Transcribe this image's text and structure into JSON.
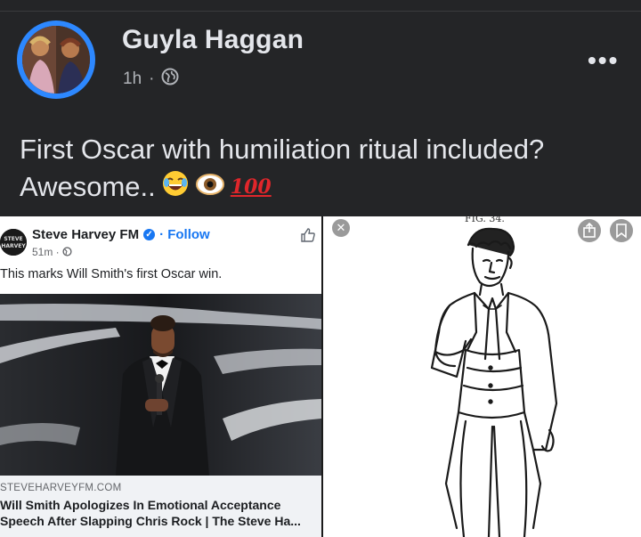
{
  "post": {
    "author": "Guyla Haggan",
    "time": "1h",
    "separator": "·",
    "text_line1": "First Oscar with humiliation ritual included?",
    "text_line2": "Awesome..",
    "emoji_hundred": "100",
    "more_label": "•••"
  },
  "shared": {
    "source_name": "Steve Harvey FM",
    "follow_label": "· Follow",
    "time": "51m ·",
    "caption": "This marks Will Smith's first Oscar win.",
    "link_domain": "STEVEHARVEYFM.COM",
    "link_title": "Will Smith Apologizes In Emotional Acceptance Speech After Slapping Chris Rock | The Steve Ha..."
  },
  "figure": {
    "label": "FIG. 34."
  },
  "colors": {
    "dark_bg": "#242527",
    "text": "#e4e6eb",
    "muted": "#b0b3b8",
    "accent_blue": "#1877f2",
    "hundred_red": "#e0262b"
  }
}
